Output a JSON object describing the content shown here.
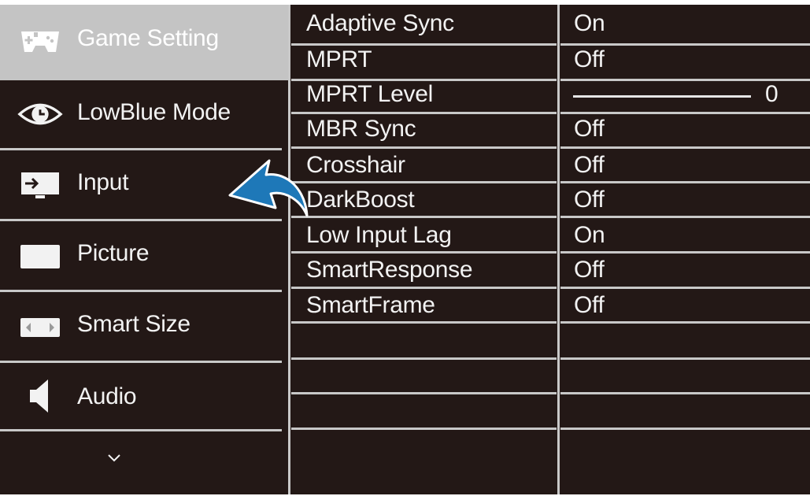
{
  "sidebar": {
    "items": [
      {
        "label": "Game Setting",
        "icon": "gamepad-icon",
        "active": true
      },
      {
        "label": "LowBlue Mode",
        "icon": "eye-icon",
        "active": false
      },
      {
        "label": "Input",
        "icon": "input-icon",
        "active": false
      },
      {
        "label": "Picture",
        "icon": "picture-icon",
        "active": false
      },
      {
        "label": "Smart Size",
        "icon": "smart-size-icon",
        "active": false
      },
      {
        "label": "Audio",
        "icon": "speaker-icon",
        "active": false
      }
    ],
    "more_icon": "chevron-down-icon"
  },
  "settings": [
    {
      "name": "Adaptive Sync",
      "value": "On"
    },
    {
      "name": "MPRT",
      "value": "Off"
    },
    {
      "name": "MPRT Level",
      "value": "0",
      "slider": true
    },
    {
      "name": "MBR Sync",
      "value": "Off"
    },
    {
      "name": "Crosshair",
      "value": "Off"
    },
    {
      "name": "DarkBoost",
      "value": "Off"
    },
    {
      "name": "Low Input Lag",
      "value": "On"
    },
    {
      "name": "SmartResponse",
      "value": "Off"
    },
    {
      "name": "SmartFrame",
      "value": "Off"
    }
  ],
  "colors": {
    "background": "#231816",
    "active_item": "#c4c4c4",
    "separator": "#c8c8c8",
    "text": "#f2f2f2",
    "arrow": "#1e78b8"
  }
}
